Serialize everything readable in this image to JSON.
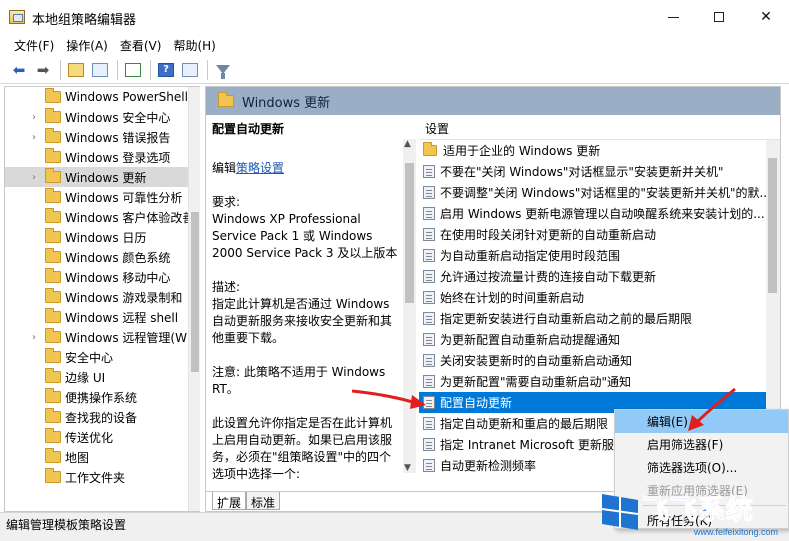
{
  "window": {
    "title": "本地组策略编辑器"
  },
  "menu": [
    "文件(F)",
    "操作(A)",
    "查看(V)",
    "帮助(H)"
  ],
  "tree": {
    "items": [
      {
        "label": "Windows PowerShell",
        "expandable": false
      },
      {
        "label": "Windows 安全中心",
        "expandable": true
      },
      {
        "label": "Windows 错误报告",
        "expandable": true
      },
      {
        "label": "Windows 登录选项",
        "expandable": false
      },
      {
        "label": "Windows 更新",
        "expandable": true,
        "selected": true
      },
      {
        "label": "Windows 可靠性分析",
        "expandable": false
      },
      {
        "label": "Windows 客户体验改善",
        "expandable": false
      },
      {
        "label": "Windows 日历",
        "expandable": false
      },
      {
        "label": "Windows 颜色系统",
        "expandable": false
      },
      {
        "label": "Windows 移动中心",
        "expandable": false
      },
      {
        "label": "Windows 游戏录制和",
        "expandable": false
      },
      {
        "label": "Windows 远程 shell",
        "expandable": false
      },
      {
        "label": "Windows 远程管理(W",
        "expandable": true
      },
      {
        "label": "安全中心",
        "expandable": false
      },
      {
        "label": "边缘 UI",
        "expandable": false
      },
      {
        "label": "便携操作系统",
        "expandable": false
      },
      {
        "label": "查找我的设备",
        "expandable": false
      },
      {
        "label": "传送优化",
        "expandable": false
      },
      {
        "label": "地图",
        "expandable": false
      },
      {
        "label": "工作文件夹",
        "expandable": false
      }
    ]
  },
  "pane": {
    "header": "Windows 更新",
    "description": {
      "title": "配置自动更新",
      "edit_prefix": "编辑",
      "edit_link": "策略设置",
      "requirements_label": "要求:",
      "requirements": "Windows XP Professional Service Pack 1 或 Windows 2000 Service Pack 3 及以上版本",
      "desc_label": "描述:",
      "desc": "指定此计算机是否通过 Windows 自动更新服务来接收安全更新和其他重要下载。",
      "note": "注意: 此策略不适用于 Windows RT。",
      "more": "此设置允许你指定是否在此计算机上启用自动更新。如果已启用该服务，必须在\"组策略设置\"中的四个选项中选择一个:"
    },
    "settings_header": "设置",
    "settings": [
      {
        "label": "适用于企业的 Windows 更新",
        "type": "folder"
      },
      {
        "label": "不要在\"关闭 Windows\"对话框显示\"安装更新并关机\"",
        "type": "policy"
      },
      {
        "label": "不要调整\"关闭 Windows\"对话框里的\"安装更新并关机\"的默...",
        "type": "policy"
      },
      {
        "label": "启用 Windows 更新电源管理以自动唤醒系统来安装计划的...",
        "type": "policy"
      },
      {
        "label": "在使用时段关闭针对更新的自动重新启动",
        "type": "policy"
      },
      {
        "label": "为自动重新启动指定使用时段范围",
        "type": "policy"
      },
      {
        "label": "允许通过按流量计费的连接自动下载更新",
        "type": "policy"
      },
      {
        "label": "始终在计划的时间重新启动",
        "type": "policy"
      },
      {
        "label": "指定更新安装进行自动重新启动之前的最后期限",
        "type": "policy"
      },
      {
        "label": "为更新配置自动重新启动提醒通知",
        "type": "policy"
      },
      {
        "label": "关闭安装更新时的自动重新启动通知",
        "type": "policy"
      },
      {
        "label": "为更新配置\"需要自动重新启动\"通知",
        "type": "policy"
      },
      {
        "label": "配置自动更新",
        "type": "policy",
        "selected": true
      },
      {
        "label": "指定自动更新和重启的最后期限",
        "type": "policy"
      },
      {
        "label": "指定 Intranet Microsoft 更新服",
        "type": "policy"
      },
      {
        "label": "自动更新检测频率",
        "type": "policy"
      }
    ],
    "tabs": [
      "扩展",
      "标准"
    ]
  },
  "context_menu": {
    "items": [
      {
        "label": "编辑(E)",
        "state": "hover"
      },
      {
        "label": "启用筛选器(F)",
        "state": "normal"
      },
      {
        "label": "筛选器选项(O)...",
        "state": "normal"
      },
      {
        "label": "重新应用筛选器(E)",
        "state": "disabled"
      },
      {
        "label": "所有任务(K)",
        "state": "normal"
      }
    ]
  },
  "status": "编辑管理模板策略设置",
  "watermark": {
    "text": "飞飞系统",
    "url": "www.feifeixitong.com"
  },
  "colors": {
    "selection": "#0078d7",
    "header": "#9aaec5",
    "menu_hover": "#91c9f7",
    "annotation": "#e0201e"
  }
}
